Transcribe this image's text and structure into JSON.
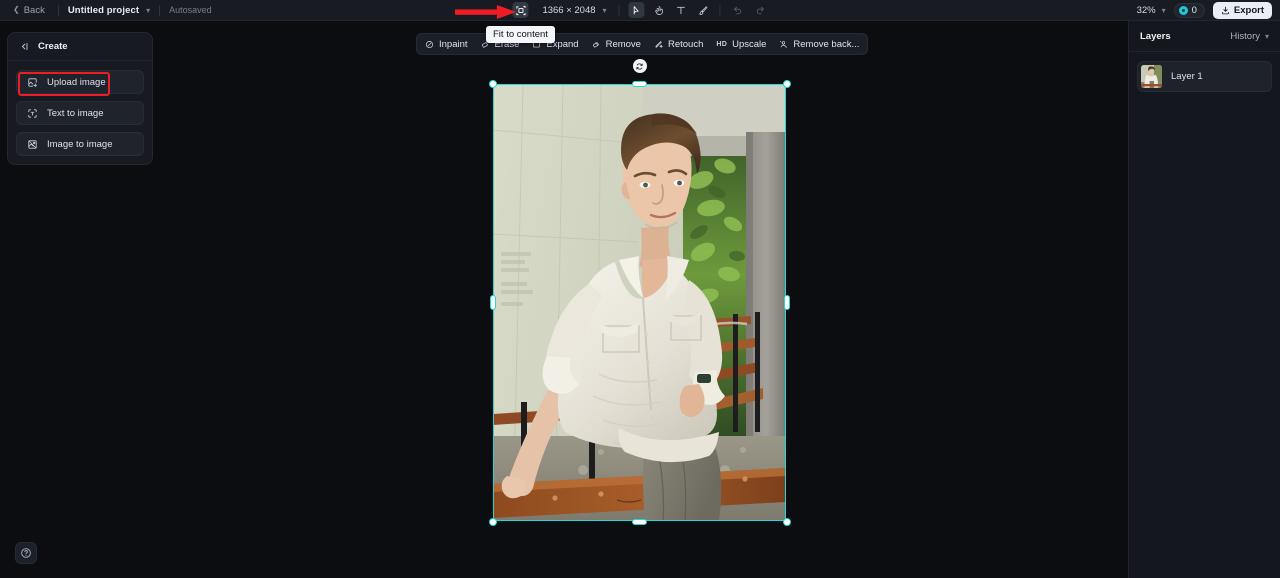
{
  "topbar": {
    "back_label": "Back",
    "project_title": "Untitled project",
    "autosaved_label": "Autosaved",
    "fit_to_content_icon": "fit-to-content-icon",
    "canvas_dimensions": "1366 × 2048",
    "tools": [
      {
        "name": "select-tool",
        "icon": "cursor-arrow-icon",
        "active": true
      },
      {
        "name": "hand-tool",
        "icon": "hand-icon",
        "active": false
      },
      {
        "name": "text-tool",
        "icon": "text-t-icon",
        "active": false
      },
      {
        "name": "brush-tool",
        "icon": "brush-icon",
        "active": false
      }
    ],
    "undo_icon": "undo-arrow-icon",
    "redo_icon": "redo-arrow-icon",
    "zoom_level": "32%",
    "credits_count": "0",
    "export_label": "Export"
  },
  "tooltip": {
    "text": "Fit to content"
  },
  "create_panel": {
    "title": "Create",
    "collapse_icon": "collapse-panel-icon",
    "items": [
      {
        "label": "Upload image",
        "icon": "image-plus-icon",
        "highlighted": true
      },
      {
        "label": "Text to image",
        "icon": "text-box-icon",
        "highlighted": false
      },
      {
        "label": "Image to image",
        "icon": "image-stack-icon",
        "highlighted": false
      }
    ]
  },
  "float_toolbar": {
    "items": [
      {
        "label": "Inpaint",
        "icon": "inpaint-icon"
      },
      {
        "label": "Erase",
        "icon": "eraser-icon"
      },
      {
        "label": "Expand",
        "icon": "expand-icon"
      },
      {
        "label": "Remove",
        "icon": "remove-icon"
      },
      {
        "label": "Retouch",
        "icon": "retouch-icon"
      },
      {
        "label": "Upscale",
        "icon": "hd-icon",
        "badge": "HD"
      },
      {
        "label": "Remove back...",
        "icon": "remove-background-icon"
      }
    ]
  },
  "canvas": {
    "selection_color": "#26d7d7",
    "rotate_handle_icon": "rotate-icon",
    "image_alt": "young-man-white-shirt-leaning-on-bench"
  },
  "right_panel": {
    "layers_tab": "Layers",
    "history_tab": "History",
    "layers": [
      {
        "name": "Layer 1"
      }
    ]
  },
  "help": {
    "icon": "question-mark-icon"
  },
  "colors": {
    "accent_cyan": "#26d7d7",
    "annotation_red": "#ee1c25",
    "panel_bg": "#171a21",
    "canvas_bg": "#0b0d11"
  }
}
